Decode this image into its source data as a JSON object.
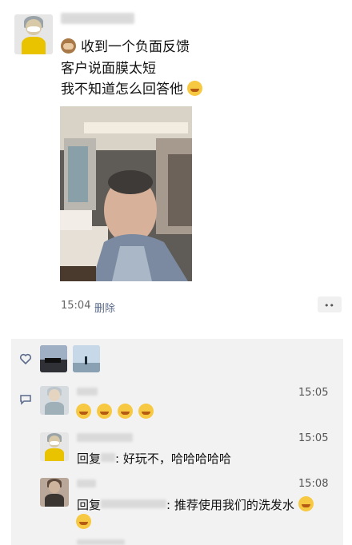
{
  "post": {
    "line1": "收到一个负面反馈",
    "line2": "客户说面膜太短",
    "line3": "我不知道怎么回答他",
    "time": "15:04",
    "delete_label": "删除",
    "more_label": "••"
  },
  "comments": [
    {
      "time": "15:05",
      "emoji_count": 4
    },
    {
      "time": "15:05",
      "reply_prefix": "回复",
      "text": ": 好玩不，哈哈哈哈哈"
    },
    {
      "time": "15:08",
      "reply_prefix": "回复",
      "text": ": 推荐使用我们的洗发水"
    }
  ],
  "icons": {
    "like": "heart-icon",
    "comment": "comment-icon"
  },
  "colors": {
    "panel_bg": "#f2f2f2",
    "emoji_yellow": "#f7c841"
  }
}
